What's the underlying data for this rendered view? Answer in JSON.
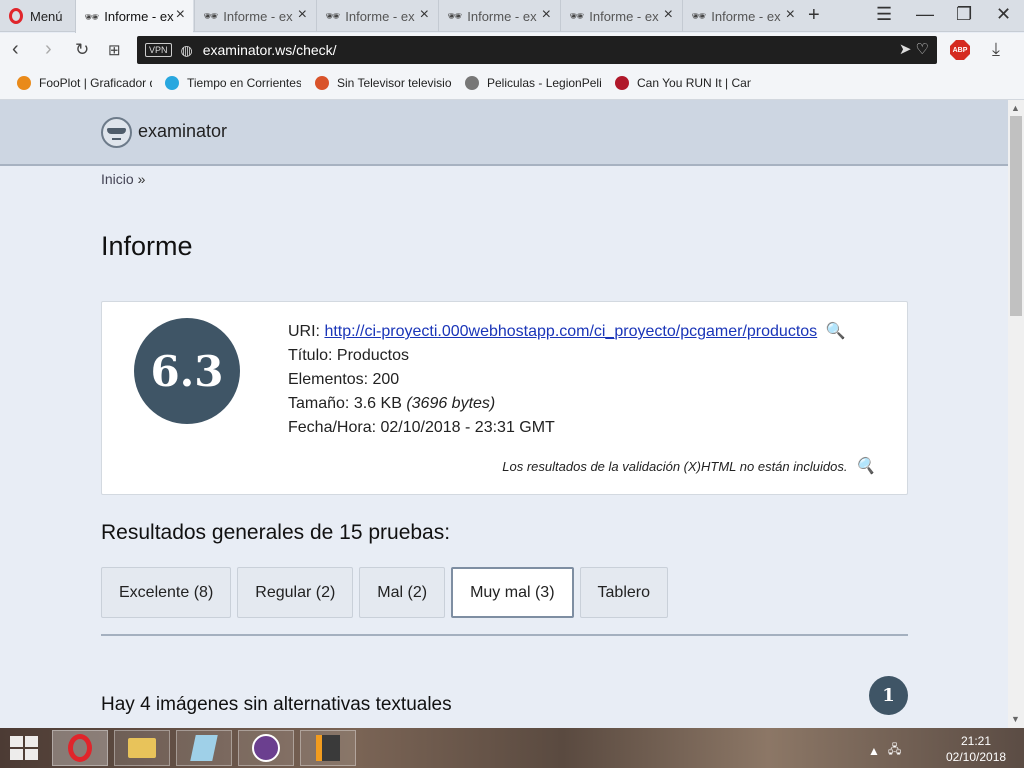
{
  "browser": {
    "menu_label": "Menú",
    "tabs": [
      {
        "label": "Informe - examinator",
        "active": true
      },
      {
        "label": "Informe - examinator"
      },
      {
        "label": "Informe - examinator"
      },
      {
        "label": "Informe - examinator"
      },
      {
        "label": "Informe - examinator"
      },
      {
        "label": "Informe - examinator"
      }
    ],
    "new_tab": "+",
    "vpn_badge": "VPN",
    "url": "examinator.ws/check/",
    "adblock": "ABP",
    "bookmarks": [
      {
        "label": "FooPlot | Graficador d",
        "color": "#e98a1a"
      },
      {
        "label": "Tiempo en Corrientes",
        "color": "#28a7df"
      },
      {
        "label": "Sin Televisor televisio",
        "color": "#d9532a"
      },
      {
        "label": "Peliculas - LegionPeli",
        "color": "#777777"
      },
      {
        "label": "Can You RUN It | Can",
        "color": "#b0182a"
      }
    ]
  },
  "site": {
    "name": "examinator",
    "breadcrumb_home": "Inicio",
    "breadcrumb_sep": "»",
    "page_title": "Informe",
    "report": {
      "score": "6.3",
      "uri_label": "URI:",
      "uri": "http://ci-proyecti.000webhostapp.com/ci_proyecto/pcgamer/productos",
      "title_label": "Título:",
      "title_value": "Productos",
      "elements_label": "Elementos:",
      "elements_value": "200",
      "size_label": "Tamaño:",
      "size_value": "3.6 KB",
      "size_bytes": "(3696 bytes)",
      "datetime_label": "Fecha/Hora:",
      "datetime_value": "02/10/2018 - 23:31 GMT",
      "note": "Los resultados de la validación (X)HTML no están incluidos."
    },
    "results_title": "Resultados generales de 15 pruebas:",
    "filters": [
      {
        "label": "Excelente (8)"
      },
      {
        "label": "Regular (2)"
      },
      {
        "label": "Mal (2)"
      },
      {
        "label": "Muy mal (3)",
        "selected": true
      },
      {
        "label": "Tablero"
      }
    ],
    "issue": {
      "title": "Hay 4 imágenes sin alternativas textuales",
      "number": "1"
    }
  },
  "taskbar": {
    "time": "21:21",
    "date": "02/10/2018"
  },
  "colors": {
    "score_badge": "#3f5566",
    "link": "#1a35b8",
    "header_bg": "#cdd6e2",
    "page_bg": "#e8edf5"
  }
}
